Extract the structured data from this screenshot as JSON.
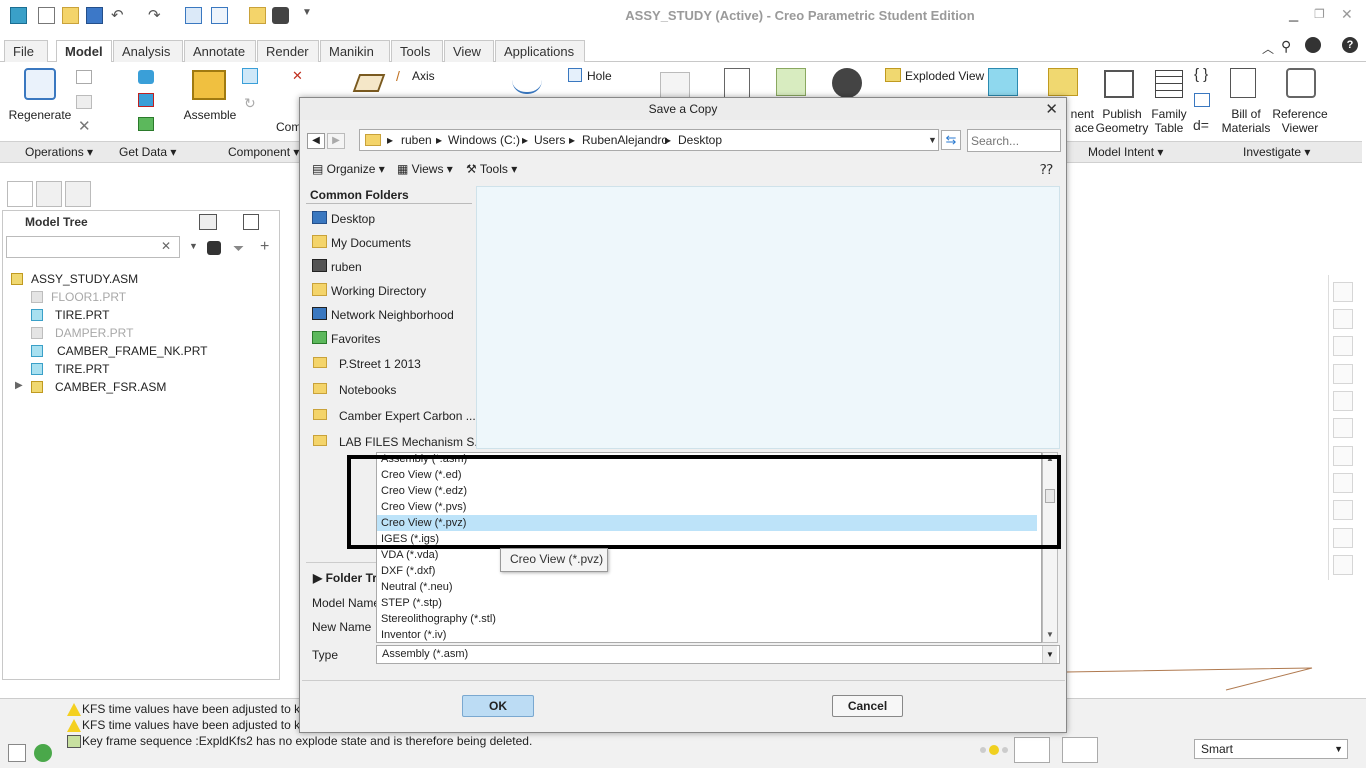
{
  "window": {
    "title": "ASSY_STUDY (Active) - Creo Parametric Student Edition"
  },
  "tabs": [
    "File",
    "Model",
    "Analysis",
    "Annotate",
    "Render",
    "Manikin",
    "Tools",
    "View",
    "Applications"
  ],
  "ribbon": {
    "regenerate": "Regenerate",
    "assemble": "Assemble",
    "com_partial": "Com",
    "axis": "Axis",
    "hole": "Hole",
    "exploded_view": "Exploded View",
    "publish_geometry": "Publish\nGeometry",
    "family_table": "Family\nTable",
    "bill_of_materials": "Bill of\nMaterials",
    "reference_viewer": "Reference\nViewer",
    "component_interface_partial": "nent\nace",
    "groups": {
      "operations": "Operations",
      "get_data": "Get Data",
      "component": "Component",
      "model_intent": "Model Intent",
      "investigate": "Investigate"
    }
  },
  "model_tree": {
    "title": "Model Tree",
    "items": [
      {
        "label": "ASSY_STUDY.ASM"
      },
      {
        "label": "FLOOR1.PRT"
      },
      {
        "label": "TIRE.PRT"
      },
      {
        "label": "DAMPER.PRT"
      },
      {
        "label": "CAMBER_FRAME_NK.PRT"
      },
      {
        "label": "TIRE.PRT"
      },
      {
        "label": "CAMBER_FSR.ASM"
      }
    ]
  },
  "dialog": {
    "title": "Save a Copy",
    "path": [
      "ruben",
      "Windows (C:)",
      "Users",
      "RubenAlejandro",
      "Desktop"
    ],
    "search_placeholder": "Search...",
    "organize": "Organize",
    "views": "Views",
    "tools": "Tools",
    "common_folders_title": "Common Folders",
    "common_folders": [
      "Desktop",
      "My Documents",
      "ruben",
      "Working Directory",
      "Network Neighborhood",
      "Favorites"
    ],
    "folders": [
      "P.Street 1 2013",
      "Notebooks",
      "Camber Expert Carbon ...",
      "LAB FILES Mechanism S..."
    ],
    "folder_tree": "Folder Tr",
    "model_name_label": "Model Name",
    "new_name_label": "New Name",
    "type_label": "Type",
    "type_value": "Assembly (*.asm)",
    "type_options": [
      "Assembly (*.asm)",
      "Creo View (*.ed)",
      "Creo View (*.edz)",
      "Creo View (*.pvs)",
      "Creo View (*.pvz)",
      "IGES (*.igs)",
      "VDA (*.vda)",
      "DXF (*.dxf)",
      "Neutral (*.neu)",
      "STEP (*.stp)",
      "Stereolithography (*.stl)",
      "Inventor (*.iv)"
    ],
    "selected_option": "Creo View (*.pvz)",
    "tooltip": "Creo View (*.pvz)",
    "ok": "OK",
    "cancel": "Cancel"
  },
  "messages": [
    "KFS time values have been adjusted to keep",
    "KFS time values have been adjusted to keep",
    "Key frame sequence :ExpldKfs2 has no explode state and is therefore being deleted."
  ],
  "status": {
    "filter": "Smart"
  }
}
